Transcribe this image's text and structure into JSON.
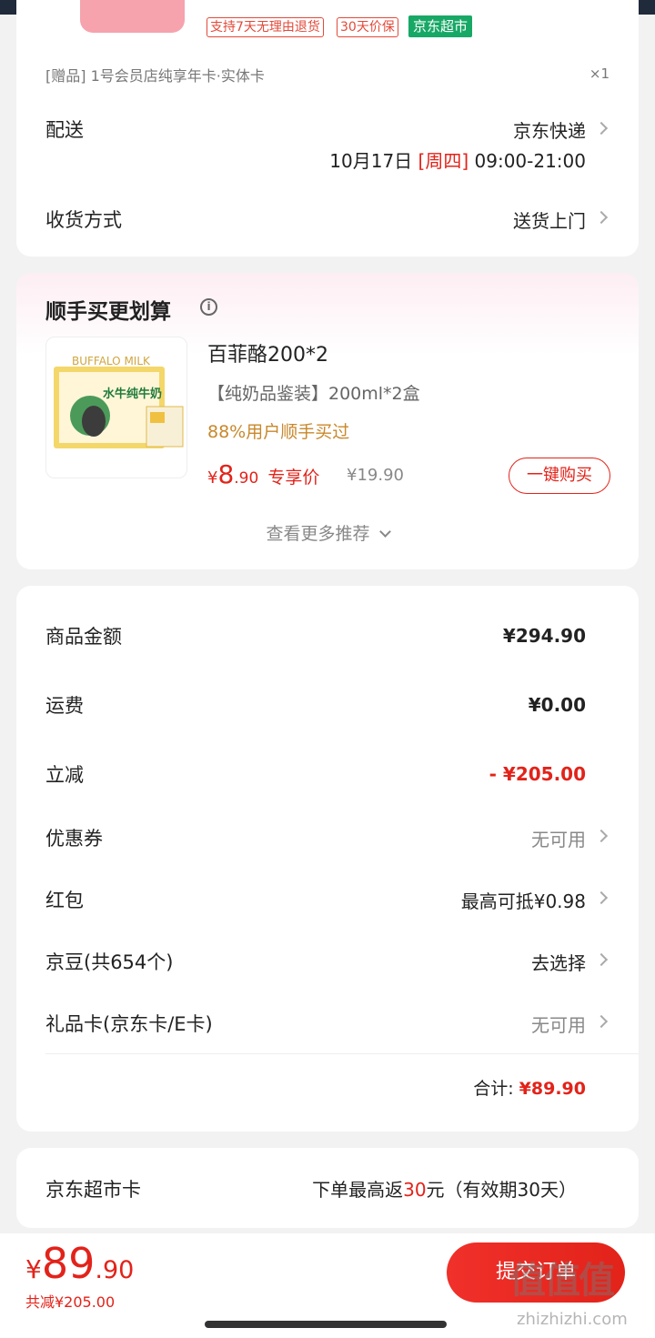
{
  "top_card": {
    "tags": [
      "支持7天无理由退货",
      "30天价保"
    ],
    "badge": "京东超市",
    "gift_item": "[赠品]  1号会员店纯享年卡·实体卡",
    "gift_qty": "×1",
    "delivery": {
      "label": "配送",
      "carrier": "京东快递",
      "date": "10月17日",
      "weekday": "[周四]",
      "time": "09:00-21:00"
    },
    "receive": {
      "label": "收货方式",
      "value": "送货上门"
    }
  },
  "recommend": {
    "title": "顺手买更划算",
    "product": {
      "name": "百菲酪200*2",
      "spec": "【纯奶品鉴装】200ml*2盒",
      "bought": "88%用户顺手买过",
      "price_symbol": "¥",
      "price_int": "8",
      "price_dec": ".90",
      "price_label": "专享价",
      "orig_price": "¥19.90",
      "image_text": "水牛纯牛奶",
      "image_brand": "BUFFALO MILK"
    },
    "buy_button": "一键购买",
    "more": "查看更多推荐"
  },
  "summary": {
    "rows": [
      {
        "label": "商品金额",
        "value": "¥294.90"
      },
      {
        "label": "运费",
        "value": "¥0.00"
      },
      {
        "label": "立减",
        "value": "- ¥205.00"
      },
      {
        "label": "优惠券",
        "value": "无可用"
      },
      {
        "label": "红包",
        "value": "最高可抵¥0.98"
      },
      {
        "label": "京豆(共654个)",
        "value": "去选择"
      },
      {
        "label": "礼品卡(京东卡/E卡)",
        "value": "无可用"
      }
    ],
    "total_label": "合计:",
    "total_value": "¥89.90"
  },
  "market_card": {
    "label": "京东超市卡",
    "value_prefix": "下单最高返",
    "value_amount": "30",
    "value_suffix": "元（有效期30天）"
  },
  "bottom": {
    "price_symbol": "¥",
    "price_int": "89",
    "price_dec": ".90",
    "saved": "共减¥205.00",
    "submit": "提交订单"
  },
  "watermark": {
    "main": "值值值",
    "sub": "zhizhizhi.com"
  },
  "colors": {
    "accent": "#e2231a",
    "green_badge": "#18a866",
    "bought_text": "#c8882b"
  }
}
